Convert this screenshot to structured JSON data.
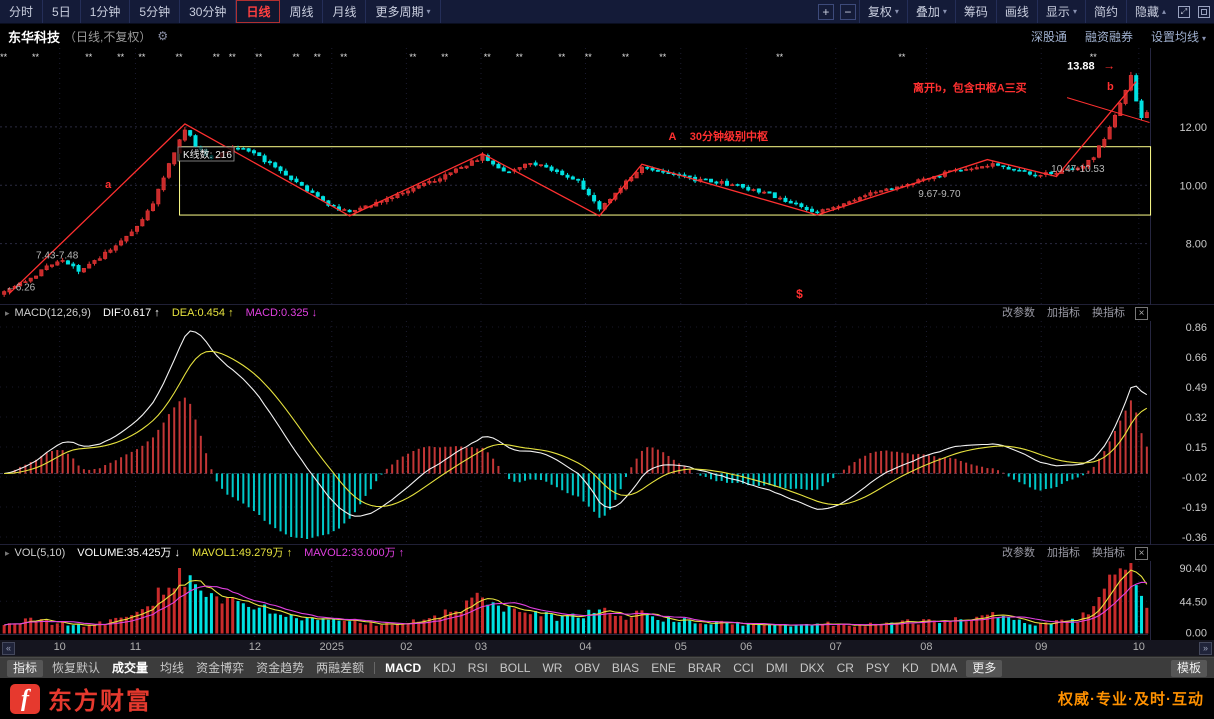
{
  "topbar": {
    "period_tabs": [
      {
        "label": "分时",
        "active": false
      },
      {
        "label": "5日",
        "active": false
      },
      {
        "label": "1分钟",
        "active": false
      },
      {
        "label": "5分钟",
        "active": false
      },
      {
        "label": "30分钟",
        "active": false
      },
      {
        "label": "日线",
        "active": true
      },
      {
        "label": "周线",
        "active": false
      },
      {
        "label": "月线",
        "active": false
      },
      {
        "label": "更多周期",
        "active": false,
        "caret": "▾"
      }
    ],
    "zoom_in_label": "+",
    "zoom_out_label": "−",
    "tool_buttons": [
      {
        "label": "复权",
        "caret": "▾"
      },
      {
        "label": "叠加",
        "caret": "▾"
      },
      {
        "label": "筹码"
      },
      {
        "label": "画线"
      },
      {
        "label": "显示",
        "caret": "▾"
      },
      {
        "label": "简约"
      },
      {
        "label": "隐藏",
        "caret": "▴"
      }
    ],
    "fullscreen_glyph": "⤢"
  },
  "titlebar": {
    "stock_name": "东华科技",
    "mode_label": "（日线,不复权）",
    "gear_icon": "⚙",
    "links": [
      "深股通",
      "融资融券"
    ],
    "ma_settings": {
      "label": "设置均线",
      "caret": "▾"
    }
  },
  "panel_header_icon": "▸",
  "panel_actions": {
    "items": [
      "改参数",
      "加指标",
      "换指标"
    ],
    "close_label": "×"
  },
  "price_panel": {
    "peak_label": {
      "text": "13.88",
      "arrow": "→"
    },
    "kline_count_label": "K线数: 216",
    "red_annotations": [
      {
        "text": "离开b，包含中枢A三买",
        "i": 171,
        "price": 13.35,
        "size": 11,
        "bold": true
      },
      {
        "text": "b",
        "i": 207.5,
        "price": 13.4,
        "size": 11,
        "bold": true
      },
      {
        "text": "A",
        "i": 125,
        "price": 11.68,
        "size": 11,
        "bold": true
      },
      {
        "text": "30分钟级别中枢",
        "i": 129,
        "price": 11.68,
        "size": 11,
        "bold": true
      },
      {
        "text": "a",
        "i": 19,
        "price": 10.05,
        "size": 11,
        "bold": true
      },
      {
        "text": "$",
        "i": 149,
        "price": 6.28,
        "size": 12,
        "bold": true
      }
    ],
    "zone_labels": [
      {
        "text": "10.47-10.53",
        "i": 197,
        "price": 10.55
      },
      {
        "text": "9.67-9.70",
        "i": 172,
        "price": 9.7
      },
      {
        "text": "7.43-7.48",
        "i": 6,
        "price": 7.6
      },
      {
        "text": "←6.26",
        "i": 0.3,
        "price": 6.5
      }
    ]
  },
  "macd_panel": {
    "series_labels": [
      {
        "text": "MACD(12,26,9)",
        "color": "#cfcfcf"
      },
      {
        "text": "DIF:0.617",
        "arrow": "↑",
        "color": "#ffffff"
      },
      {
        "text": "DEA:0.454",
        "arrow": "↑",
        "color": "#e6e23e"
      },
      {
        "text": "MACD:0.325",
        "arrow": "↓",
        "color": "#e040e0"
      }
    ]
  },
  "vol_panel": {
    "series_labels": [
      {
        "text": "VOL(5,10)",
        "color": "#cfcfcf"
      },
      {
        "text": "VOLUME:35.425万",
        "arrow": "↓",
        "color": "#ffffff"
      },
      {
        "text": "MAVOL1:49.279万",
        "arrow": "↑",
        "color": "#e6e23e"
      },
      {
        "text": "MAVOL2:33.000万",
        "arrow": "↑",
        "color": "#e040e0"
      }
    ]
  },
  "date_axis": {
    "left_scroll": "«",
    "right_scroll": "»",
    "labels": [
      {
        "text": "10",
        "f": 0.052
      },
      {
        "text": "11",
        "f": 0.118
      },
      {
        "text": "12",
        "f": 0.222
      },
      {
        "text": "2025",
        "f": 0.289
      },
      {
        "text": "02",
        "f": 0.354
      },
      {
        "text": "03",
        "f": 0.419
      },
      {
        "text": "04",
        "f": 0.51
      },
      {
        "text": "05",
        "f": 0.593
      },
      {
        "text": "06",
        "f": 0.65
      },
      {
        "text": "07",
        "f": 0.728
      },
      {
        "text": "08",
        "f": 0.807
      },
      {
        "text": "09",
        "f": 0.907
      },
      {
        "text": "10",
        "f": 0.992
      }
    ]
  },
  "indicator_bar": {
    "items": [
      {
        "label": "指标",
        "chip": true
      },
      {
        "label": "恢复默认"
      },
      {
        "label": "成交量",
        "active": true
      },
      {
        "label": "均线"
      },
      {
        "label": "资金博弈"
      },
      {
        "label": "资金趋势"
      },
      {
        "label": "两融差额",
        "divider_after": true
      },
      {
        "label": "MACD",
        "active": true
      },
      {
        "label": "KDJ"
      },
      {
        "label": "RSI"
      },
      {
        "label": "BOLL"
      },
      {
        "label": "WR"
      },
      {
        "label": "OBV"
      },
      {
        "label": "BIAS"
      },
      {
        "label": "ENE"
      },
      {
        "label": "BRAR"
      },
      {
        "label": "CCI"
      },
      {
        "label": "DMI"
      },
      {
        "label": "DKX"
      },
      {
        "label": "CR"
      },
      {
        "label": "PSY"
      },
      {
        "label": "KD"
      },
      {
        "label": "DMA"
      },
      {
        "label": "更多",
        "chip": true
      },
      {
        "label": "模板",
        "chip": true,
        "right": true
      }
    ]
  },
  "footer": {
    "logo_letter": "f",
    "brand": "东方财富",
    "slogan": "权威·专业·及时·互动"
  },
  "colors": {
    "up": "#e23535",
    "up_fill": "#c92b2b",
    "down": "#00e2e2",
    "dif_line": "#f2f2f2",
    "dea_line": "#e6e23e",
    "mavol1": "#e6e23e",
    "mavol2": "#e040e0",
    "annotation_red": "#ff3030",
    "box_yellow": "#ffff8a",
    "axis_text": "#c9c9c9",
    "zone_text": "#b8b8b8"
  },
  "chart_data": {
    "type": "candlestick+macd+volume",
    "symbol": "东华科技",
    "kline_count": 216,
    "price_axis": {
      "min": 5.9,
      "max": 14.7,
      "gridlines": [
        12,
        10,
        8
      ],
      "labels": [
        "12.00",
        "10.00",
        "8.00"
      ]
    },
    "last_high": 13.88,
    "period_low": 6.26,
    "x_axis_labels": [
      "10",
      "11",
      "12",
      "2025",
      "02",
      "03",
      "04",
      "05",
      "06",
      "07",
      "08",
      "09",
      "10"
    ],
    "price_anchors": [
      [
        0,
        6.35
      ],
      [
        4,
        6.7
      ],
      [
        8,
        7.2
      ],
      [
        11,
        7.45
      ],
      [
        14,
        7.1
      ],
      [
        17,
        7.4
      ],
      [
        21,
        7.9
      ],
      [
        25,
        8.6
      ],
      [
        28,
        9.4
      ],
      [
        31,
        10.7
      ],
      [
        34,
        11.95
      ],
      [
        36,
        11.35
      ],
      [
        39,
        10.9
      ],
      [
        43,
        11.3
      ],
      [
        47,
        11.1
      ],
      [
        52,
        10.45
      ],
      [
        57,
        9.85
      ],
      [
        61,
        9.35
      ],
      [
        65,
        9.05
      ],
      [
        70,
        9.4
      ],
      [
        76,
        9.8
      ],
      [
        82,
        10.25
      ],
      [
        86,
        10.6
      ],
      [
        90,
        11.0
      ],
      [
        94,
        10.45
      ],
      [
        99,
        10.75
      ],
      [
        104,
        10.5
      ],
      [
        108,
        10.15
      ],
      [
        112,
        9.2
      ],
      [
        116,
        9.95
      ],
      [
        120,
        10.6
      ],
      [
        125,
        10.4
      ],
      [
        130,
        10.2
      ],
      [
        136,
        10.05
      ],
      [
        142,
        9.8
      ],
      [
        147,
        9.5
      ],
      [
        153,
        9.05
      ],
      [
        158,
        9.4
      ],
      [
        163,
        9.7
      ],
      [
        168,
        9.95
      ],
      [
        173,
        10.2
      ],
      [
        178,
        10.45
      ],
      [
        182,
        10.55
      ],
      [
        186,
        10.75
      ],
      [
        190,
        10.5
      ],
      [
        194,
        10.35
      ],
      [
        198,
        10.45
      ],
      [
        202,
        10.55
      ],
      [
        205,
        11.0
      ],
      [
        207,
        11.6
      ],
      [
        209,
        12.35
      ],
      [
        211,
        13.2
      ],
      [
        212,
        13.75
      ],
      [
        213,
        12.9
      ],
      [
        214,
        12.3
      ],
      [
        215,
        12.45
      ]
    ],
    "volume_anchors": [
      [
        0,
        12
      ],
      [
        5,
        18
      ],
      [
        10,
        14
      ],
      [
        15,
        10
      ],
      [
        20,
        16
      ],
      [
        25,
        32
      ],
      [
        28,
        50
      ],
      [
        31,
        72
      ],
      [
        33,
        90
      ],
      [
        35,
        72
      ],
      [
        38,
        55
      ],
      [
        41,
        46
      ],
      [
        44,
        40
      ],
      [
        48,
        34
      ],
      [
        52,
        27
      ],
      [
        57,
        20
      ],
      [
        61,
        16
      ],
      [
        65,
        18
      ],
      [
        70,
        14
      ],
      [
        76,
        15
      ],
      [
        80,
        18
      ],
      [
        84,
        32
      ],
      [
        88,
        44
      ],
      [
        90,
        50
      ],
      [
        93,
        36
      ],
      [
        97,
        28
      ],
      [
        101,
        25
      ],
      [
        105,
        21
      ],
      [
        109,
        26
      ],
      [
        112,
        32
      ],
      [
        116,
        24
      ],
      [
        120,
        26
      ],
      [
        126,
        18
      ],
      [
        132,
        15
      ],
      [
        138,
        13
      ],
      [
        144,
        12
      ],
      [
        150,
        11
      ],
      [
        153,
        15
      ],
      [
        158,
        12
      ],
      [
        163,
        13
      ],
      [
        168,
        15
      ],
      [
        173,
        17
      ],
      [
        178,
        19
      ],
      [
        182,
        21
      ],
      [
        186,
        24
      ],
      [
        190,
        17
      ],
      [
        194,
        14
      ],
      [
        198,
        15
      ],
      [
        202,
        17
      ],
      [
        205,
        42
      ],
      [
        207,
        58
      ],
      [
        209,
        72
      ],
      [
        211,
        88
      ],
      [
        212,
        78
      ],
      [
        213,
        58
      ],
      [
        214,
        44
      ],
      [
        215,
        35.4
      ]
    ],
    "ex_rights_indices": [
      0,
      6,
      16,
      22,
      26,
      33,
      40,
      43,
      48,
      55,
      59,
      64,
      77,
      83,
      91,
      97,
      105,
      110,
      117,
      124,
      146,
      169,
      205
    ],
    "ex_rights_glyph": "**",
    "center_box": {
      "i0": 33,
      "i1": 215.7,
      "price_top": 11.32,
      "price_bottom": 8.98
    },
    "zigzag_points": [
      [
        1,
        6.3
      ],
      [
        34,
        12.1
      ],
      [
        65,
        8.95
      ],
      [
        90,
        11.08
      ],
      [
        112,
        8.95
      ],
      [
        120,
        10.72
      ],
      [
        153,
        8.98
      ],
      [
        185,
        10.88
      ],
      [
        198,
        10.3
      ],
      [
        213,
        13.55
      ]
    ],
    "trend_line_b": [
      [
        200,
        13.0
      ],
      [
        215.5,
        12.15
      ]
    ],
    "macd": {
      "dif": 0.617,
      "dea": 0.454,
      "macd": 0.325,
      "axis_labels": [
        "0.86",
        "0.66",
        "0.49",
        "0.32",
        "0.15",
        "-0.02",
        "-0.19",
        "-0.36"
      ]
    },
    "volume": {
      "volume_wan": 35.425,
      "mavol1_wan": 49.279,
      "mavol2_wan": 33.0,
      "axis_labels": [
        "90.40",
        "44.50",
        "0.00"
      ]
    }
  }
}
